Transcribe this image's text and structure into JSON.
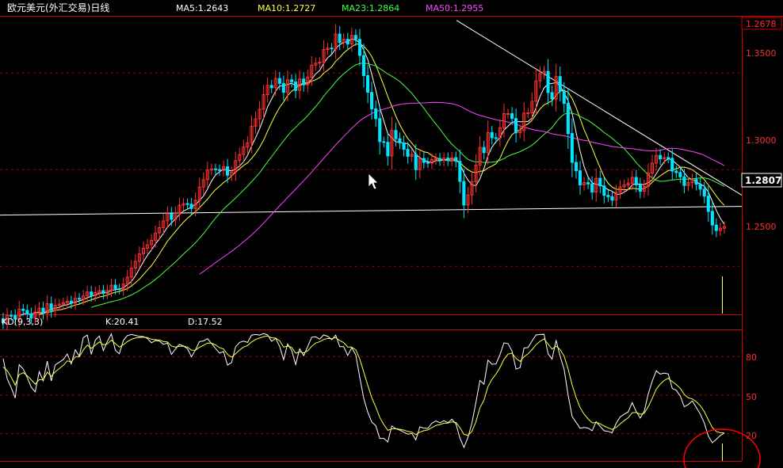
{
  "header": {
    "title": "欧元美元(外汇交易)日线",
    "indicators": [
      {
        "label": "MA5:1.2643",
        "color": "#ffffff"
      },
      {
        "label": "MA10:1.2727",
        "color": "#ffff44"
      },
      {
        "label": "MA23:1.2864",
        "color": "#44ff44"
      },
      {
        "label": "MA50:1.2955",
        "color": "#ff44ff"
      }
    ]
  },
  "price_axis": {
    "ticks": [
      "1.3500",
      "1.3000",
      "1.2500"
    ],
    "top_value": "1.2678",
    "current_value": "1.2807"
  },
  "kd_panel": {
    "label": "KD(9,3,3)",
    "k_label": "K:20.41",
    "d_label": "D:17.52",
    "ticks": [
      "80",
      "50",
      "20"
    ]
  },
  "chart_data": [
    {
      "type": "candlestick",
      "ylim": [
        1.2255,
        1.3788
      ],
      "price_gridlines": [
        1.35,
        1.3,
        1.25
      ],
      "closes": [
        1.2207,
        1.2246,
        1.2245,
        1.2227,
        1.2278,
        1.2271,
        1.2253,
        1.2232,
        1.2263,
        1.2283,
        1.2258,
        1.2306,
        1.2271,
        1.2298,
        1.2304,
        1.2311,
        1.2319,
        1.2309,
        1.2334,
        1.2329,
        1.2346,
        1.2367,
        1.2348,
        1.2364,
        1.2374,
        1.236,
        1.2375,
        1.2402,
        1.2384,
        1.2381,
        1.2408,
        1.2444,
        1.249,
        1.2525,
        1.2564,
        1.2593,
        1.2611,
        1.2634,
        1.2672,
        1.27,
        1.2735,
        1.2772,
        1.2743,
        1.2774,
        1.2816,
        1.2824,
        1.2821,
        1.2799,
        1.2842,
        1.291,
        1.2948,
        1.2998,
        1.3004,
        1.3,
        1.2996,
        1.3015,
        1.2971,
        1.2987,
        1.3047,
        1.3078,
        1.3117,
        1.314,
        1.3225,
        1.3263,
        1.3313,
        1.3388,
        1.3436,
        1.3424,
        1.3472,
        1.3446,
        1.34,
        1.3465,
        1.3454,
        1.341,
        1.3469,
        1.3439,
        1.3479,
        1.3541,
        1.3551,
        1.3556,
        1.3622,
        1.3629,
        1.3625,
        1.3702,
        1.3659,
        1.3675,
        1.3651,
        1.3695,
        1.3674,
        1.3591,
        1.3487,
        1.34,
        1.3315,
        1.3264,
        1.3145,
        1.3141,
        1.3071,
        1.3203,
        1.316,
        1.3139,
        1.3105,
        1.3069,
        1.3079,
        1.3,
        1.3057,
        1.3037,
        1.3034,
        1.3052,
        1.3058,
        1.3048,
        1.306,
        1.3048,
        1.3062,
        1.3043,
        1.2939,
        1.2817,
        1.2869,
        1.2937,
        1.3023,
        1.3115,
        1.3088,
        1.3192,
        1.3165,
        1.3163,
        1.3217,
        1.329,
        1.329,
        1.3265,
        1.3191,
        1.3203,
        1.3293,
        1.3294,
        1.3354,
        1.3459,
        1.3497,
        1.3509,
        1.3399,
        1.3366,
        1.3482,
        1.3406,
        1.3343,
        1.3187,
        1.3038,
        1.2994,
        1.2921,
        1.2933,
        1.2926,
        1.2884,
        1.2955,
        1.2916,
        1.2867,
        1.286,
        1.2842,
        1.2883,
        1.2911,
        1.2921,
        1.293,
        1.296,
        1.2921,
        1.2888,
        1.2914,
        1.2982,
        1.3034,
        1.3074,
        1.3056,
        1.3063,
        1.3059,
        1.2993,
        1.2985,
        1.2963,
        1.2918,
        1.2932,
        1.2949,
        1.2925,
        1.2899,
        1.2863,
        1.2784,
        1.2713,
        1.2685,
        1.2697,
        1.2705
      ]
    },
    {
      "type": "line",
      "title": "KD(9,3,3)",
      "ylim": [
        0,
        100
      ],
      "gridlines": [
        80,
        50,
        20
      ],
      "series": [
        {
          "name": "K",
          "values": [
            78.5,
            62.8,
            56.0,
            47.8,
            73.7,
            70.4,
            63.8,
            56.2,
            52.5,
            68.3,
            61.2,
            76.5,
            61.1,
            73.6,
            75.7,
            77.7,
            82.1,
            74.4,
            85.4,
            80.3,
            94.9,
            96.8,
            81.8,
            92.9,
            96.1,
            84.7,
            91.8,
            97.7,
            84.9,
            82.3,
            92.7,
            96.4,
            97.3,
            96.6,
            95.8,
            95.7,
            94.2,
            90.8,
            92.6,
            92.1,
            89.6,
            90.6,
            81.8,
            85.9,
            89.6,
            88.3,
            86.1,
            79.9,
            85.3,
            91.8,
            92.2,
            94.0,
            90.3,
            86.5,
            82.8,
            84.0,
            73.4,
            75.4,
            87.6,
            91.1,
            92.1,
            91.1,
            96.8,
            97.3,
            96.8,
            98.0,
            97.0,
            92.0,
            94.2,
            88.1,
            77.6,
            89.9,
            85.0,
            73.8,
            86.2,
            80.8,
            87.8,
            95.2,
            95.5,
            93.7,
            96.9,
            95.9,
            93.3,
            96.8,
            87.8,
            87.8,
            80.9,
            86.9,
            81.5,
            64.1,
            47.4,
            36.6,
            29.0,
            26.1,
            16.3,
            16.3,
            13.5,
            26.0,
            23.8,
            22.7,
            21.1,
            19.6,
            20.1,
            15.2,
            25.3,
            24.3,
            24.1,
            28.1,
            29.9,
            28.4,
            30.1,
            28.5,
            31.2,
            27.6,
            16.6,
            9.2,
            16.9,
            28.3,
            44.6,
            61.5,
            58.5,
            77.3,
            74.1,
            74.3,
            81.6,
            90.8,
            90.2,
            84.3,
            70.4,
            71.4,
            86.7,
            87.1,
            92.2,
            96.9,
            97.3,
            97.4,
            82.2,
            78.0,
            92.9,
            80.4,
            70.2,
            50.3,
            33.4,
            28.8,
            24.2,
            24.8,
            24.3,
            22.3,
            29.3,
            25.7,
            22.2,
            21.8,
            20.7,
            28.1,
            33.0,
            35.1,
            37.0,
            44.2,
            37.3,
            32.1,
            37.4,
            50.8,
            60.9,
            69.0,
            66.4,
            67.2,
            66.5,
            55.2,
            53.8,
            49.3,
            40.9,
            42.7,
            45.5,
            40.4,
            35.2,
            28.3,
            18.0,
            12.9,
            15.6,
            18.6,
            20.4
          ]
        },
        {
          "name": "D",
          "values": [
            71.9,
            69.2,
            64.0,
            57.8,
            66.0,
            67.5,
            65.3,
            62.0,
            58.6,
            62.1,
            61.8,
            67.9,
            64.7,
            68.2,
            70.7,
            73.2,
            76.7,
            75.8,
            79.8,
            79.9,
            85.2,
            89.1,
            86.5,
            88.9,
            91.6,
            89.2,
            90.0,
            92.9,
            90.2,
            87.5,
            89.3,
            91.7,
            93.5,
            94.5,
            94.9,
            95.2,
            94.9,
            93.6,
            93.3,
            92.9,
            91.8,
            91.4,
            88.2,
            87.4,
            88.1,
            88.2,
            87.5,
            85.0,
            85.1,
            87.3,
            88.9,
            90.6,
            90.5,
            89.2,
            87.0,
            86.0,
            81.8,
            79.6,
            82.3,
            85.2,
            87.5,
            88.7,
            91.4,
            93.4,
            94.5,
            95.6,
            96.1,
            94.7,
            94.5,
            92.4,
            87.5,
            88.3,
            87.2,
            82.7,
            83.9,
            82.9,
            84.5,
            88.1,
            90.6,
            91.6,
            93.4,
            94.2,
            93.9,
            94.9,
            92.5,
            90.9,
            87.6,
            87.4,
            85.4,
            78.3,
            68.0,
            57.6,
            48.0,
            40.7,
            32.6,
            27.1,
            22.6,
            23.7,
            23.8,
            23.4,
            22.7,
            21.7,
            21.2,
            19.2,
            21.2,
            22.3,
            22.9,
            24.6,
            26.4,
            27.1,
            28.1,
            28.2,
            29.2,
            28.7,
            24.7,
            19.5,
            18.6,
            21.8,
            29.4,
            40.1,
            46.2,
            56.6,
            62.4,
            66.4,
            71.5,
            77.9,
            82.0,
            82.8,
            78.7,
            76.3,
            79.8,
            82.2,
            85.5,
            89.3,
            92.0,
            93.8,
            89.9,
            85.9,
            88.2,
            85.6,
            80.5,
            70.4,
            58.1,
            48.3,
            40.3,
            35.1,
            31.5,
            28.4,
            28.7,
            27.7,
            25.9,
            24.5,
            23.3,
            24.9,
            27.6,
            30.1,
            32.4,
            36.3,
            36.6,
            35.1,
            35.9,
            40.9,
            47.5,
            54.7,
            58.6,
            61.5,
            63.2,
            60.5,
            58.3,
            55.3,
            50.5,
            47.9,
            47.1,
            44.9,
            41.7,
            37.2,
            30.8,
            24.8,
            21.7,
            20.7,
            20.6
          ]
        }
      ]
    }
  ],
  "colors": {
    "up": "#ff3030",
    "down": "#00e5ff",
    "grid": "#aa0000",
    "axis": "#cc0000",
    "trendline": "#ffffff",
    "circle": "#ff0000"
  }
}
